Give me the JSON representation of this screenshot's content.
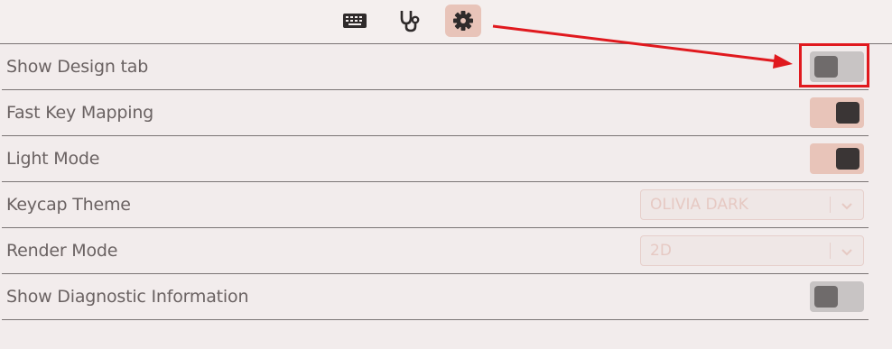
{
  "tabs": [
    {
      "name": "keyboard-tab",
      "icon": "keyboard-icon"
    },
    {
      "name": "diagnostics-tab",
      "icon": "stethoscope-icon"
    },
    {
      "name": "settings-tab",
      "icon": "gear-icon",
      "active": true
    }
  ],
  "settings": {
    "show_design_tab": {
      "label": "Show Design tab",
      "enabled": false
    },
    "fast_key_mapping": {
      "label": "Fast Key Mapping",
      "enabled": true
    },
    "light_mode": {
      "label": "Light Mode",
      "enabled": true
    },
    "keycap_theme": {
      "label": "Keycap Theme",
      "value": "OLIVIA DARK"
    },
    "render_mode": {
      "label": "Render Mode",
      "value": "2D"
    },
    "show_diagnostic_information": {
      "label": "Show Diagnostic Information",
      "enabled": false
    }
  },
  "colors": {
    "background": "#f2ecec",
    "accent": "#e8c4b9",
    "annotation": "#e0191e"
  }
}
